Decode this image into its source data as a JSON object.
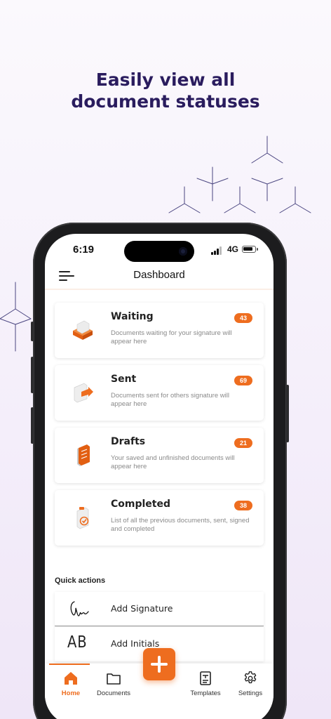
{
  "headline": {
    "line1": "Easily view all",
    "line2": "document statuses"
  },
  "colors": {
    "accent": "#ee6d1f",
    "headline": "#2a1c5e",
    "background": "#f4eefa"
  },
  "status_bar": {
    "time": "6:19",
    "network": "4G",
    "signal_bars_active": 3,
    "signal_bars_total": 4
  },
  "header": {
    "menu_icon": "menu-icon",
    "title": "Dashboard"
  },
  "status_cards": [
    {
      "title": "Waiting",
      "count": "43",
      "desc": "Documents waiting for your signature will appear here",
      "icon": "inbox-tray-icon"
    },
    {
      "title": "Sent",
      "count": "69",
      "desc": "Documents sent for others signature will appear here",
      "icon": "send-document-icon"
    },
    {
      "title": "Drafts",
      "count": "21",
      "desc": "Your saved and unfinished documents will appear here",
      "icon": "draft-stack-icon"
    },
    {
      "title": "Completed",
      "count": "38",
      "desc": "List of all the previous documents, sent, signed and completed",
      "icon": "completed-document-icon"
    }
  ],
  "quick_actions": {
    "title": "Quick actions",
    "items": [
      {
        "label": "Add Signature",
        "icon": "signature-icon"
      },
      {
        "label": "Add Initials",
        "icon": "initials-icon",
        "icon_text": "AB"
      }
    ]
  },
  "tabs": [
    {
      "label": "Home",
      "icon": "home-icon",
      "active": true
    },
    {
      "label": "Documents",
      "icon": "folder-icon",
      "active": false
    },
    {
      "label": "Templates",
      "icon": "template-icon",
      "active": false
    },
    {
      "label": "Settings",
      "icon": "gear-icon",
      "active": false
    }
  ],
  "fab": {
    "icon": "plus-icon"
  }
}
